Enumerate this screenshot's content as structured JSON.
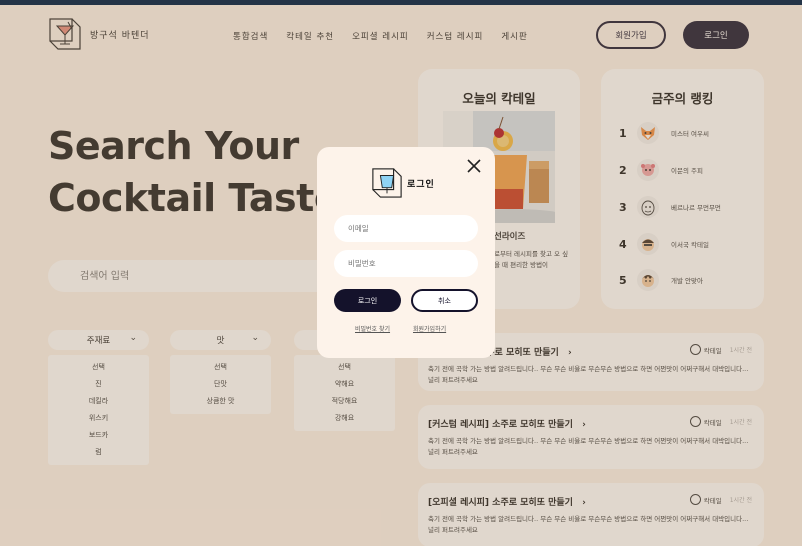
{
  "header": {
    "logo_text": "방구석 바텐더",
    "nav": [
      "통합검색",
      "칵테일 추천",
      "오피셜 레시피",
      "커스텀 레시피",
      "게시판"
    ],
    "signup_label": "회원가입",
    "login_label": "로그인"
  },
  "hero": {
    "title_line1": "Search Your",
    "title_line2": "Cocktail Taste.",
    "search_placeholder": "검색어 입력"
  },
  "filters": [
    {
      "label": "주재료",
      "options": [
        "선택",
        "진",
        "데킬라",
        "위스키",
        "보드카",
        "럼"
      ]
    },
    {
      "label": "맛",
      "options": [
        "선택",
        "단맛",
        "상큼한 맛"
      ]
    },
    {
      "label": "",
      "options": [
        "선택",
        "약해요",
        "적당해요",
        "강해요"
      ]
    }
  ],
  "today": {
    "title": "오늘의 칵테일",
    "name": "선라이즈",
    "desc": "로부터 레시피를 찾고 오 싶을 때 편리한 방법이"
  },
  "ranking": {
    "title": "금주의 랭킹",
    "items": [
      {
        "rank": "1",
        "name": "미스터 여우씨"
      },
      {
        "rank": "2",
        "name": "이문의 주피"
      },
      {
        "rank": "3",
        "name": "베르나르 무먼무먼"
      },
      {
        "rank": "4",
        "name": "이서국 칵테일"
      },
      {
        "rank": "5",
        "name": "개발 안맞아"
      }
    ]
  },
  "posts": [
    {
      "title": "소주로 모히또 만들기",
      "author": "칵테일",
      "date": "1시간 전",
      "body": "축기 전에 곡학 가는 방법 알려드립니다.. 무슨 무슨 비율로 무슨무슨 방법으로 하면 어쩐맛이 어쩌구해서 대박입니다... 널리 퍼트려주세요"
    },
    {
      "title": "[커스텀 레시피] 소주로 모히또 만들기",
      "author": "칵테일",
      "date": "1시간 전",
      "body": "축기 전에 곡학 가는 방법 알려드립니다.. 무슨 무슨 비율로 무슨무슨 방법으로 하면 어쩐맛이 어쩌구해서 대박입니다... 널리 퍼트려주세요"
    },
    {
      "title": "[오피셜 레시피] 소주로 모히또 만들기",
      "author": "칵테일",
      "date": "1시간 전",
      "body": "축기 전에 곡학 가는 방법 알려드립니다.. 무슨 무슨 비율로 무슨무슨 방법으로 하면 어쩐맛이 어쩌구해서 대박입니다... 널리 퍼트려주세요"
    }
  ],
  "modal": {
    "title": "로그인",
    "email_placeholder": "이메일",
    "password_placeholder": "비밀번호",
    "login_label": "로그인",
    "cancel_label": "취소",
    "find_password": "비밀번호 찾기",
    "signup_link": "회원가입하기"
  },
  "colors": {
    "background": "#fdf3ea",
    "primary": "#14122b",
    "overlay": "rgba(160,130,100,0.32)"
  }
}
